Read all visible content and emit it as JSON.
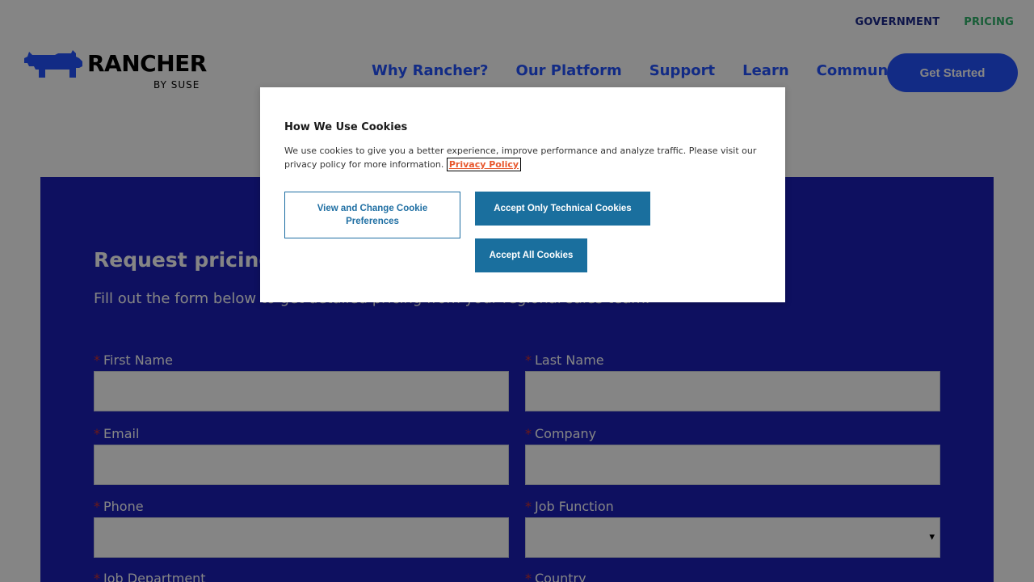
{
  "topbar": {
    "government": "GOVERNMENT",
    "pricing": "PRICING"
  },
  "logo": {
    "word": "RANCHER",
    "by": "BY SUSE"
  },
  "nav": [
    {
      "label": "Why Rancher?"
    },
    {
      "label": "Our Platform"
    },
    {
      "label": "Support"
    },
    {
      "label": "Learn"
    },
    {
      "label": "Community"
    }
  ],
  "cta": {
    "label": "Get Started"
  },
  "form": {
    "title": "Request pricing",
    "subtitle": "Fill out the form below to get detailed pricing from your regional sales team.",
    "required_mark": "*",
    "fields": {
      "first_name": "First Name",
      "last_name": "Last Name",
      "email": "Email",
      "company": "Company",
      "phone": "Phone",
      "job_function": "Job Function",
      "job_department": "Job Department",
      "country": "Country"
    }
  },
  "cookie": {
    "title": "How We Use Cookies",
    "description": "We use cookies to give you a better experience, improve performance and analyze traffic. Please visit our privacy policy for more information.",
    "privacy_link": "Privacy Policy",
    "prefs_button": "View and Change Cookie Preferences",
    "technical_button": "Accept Only Technical Cookies",
    "accept_all_button": "Accept All Cookies"
  },
  "colors": {
    "brand_blue": "#2453ff",
    "panel": "#1b1fb8",
    "pricing_green": "#2fb36a",
    "cookie_button": "#1a6f9e"
  }
}
